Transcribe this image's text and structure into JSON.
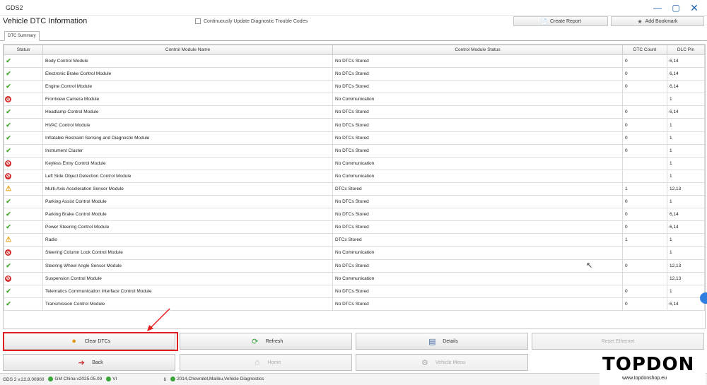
{
  "app": {
    "title": "GDS2"
  },
  "header": {
    "title": "Vehicle DTC Information",
    "continuous_update_label": "Continuously Update Diagnostic Trouble Codes",
    "create_report_label": "Create Report",
    "add_bookmark_label": "Add Bookmark"
  },
  "tabs": {
    "summary": "DTC Summary"
  },
  "table": {
    "columns": {
      "status": "Status",
      "module": "Control Module Name",
      "module_status": "Control Module Status",
      "dtc_count": "DTC Count",
      "dlc_pin": "DLC Pin"
    },
    "rows": [
      {
        "status": "ok",
        "module": "Body Control Module",
        "module_status": "No DTCs Stored",
        "dtc_count": "0",
        "dlc_pin": "6,14"
      },
      {
        "status": "ok",
        "module": "Electronic Brake Control Module",
        "module_status": "No DTCs Stored",
        "dtc_count": "0",
        "dlc_pin": "6,14"
      },
      {
        "status": "ok",
        "module": "Engine Control Module",
        "module_status": "No DTCs Stored",
        "dtc_count": "0",
        "dlc_pin": "6,14"
      },
      {
        "status": "nocomm",
        "module": "Frontview Camera Module",
        "module_status": "No Communication",
        "dtc_count": "",
        "dlc_pin": "1"
      },
      {
        "status": "ok",
        "module": "Headlamp Control Module",
        "module_status": "No DTCs Stored",
        "dtc_count": "0",
        "dlc_pin": "6,14"
      },
      {
        "status": "ok",
        "module": "HVAC Control Module",
        "module_status": "No DTCs Stored",
        "dtc_count": "0",
        "dlc_pin": "1"
      },
      {
        "status": "ok",
        "module": "Inflatable Restraint Sensing and Diagnostic Module",
        "module_status": "No DTCs Stored",
        "dtc_count": "0",
        "dlc_pin": "1"
      },
      {
        "status": "ok",
        "module": "Instrument Cluster",
        "module_status": "No DTCs Stored",
        "dtc_count": "0",
        "dlc_pin": "1"
      },
      {
        "status": "nocomm",
        "module": "Keyless Entry Control Module",
        "module_status": "No Communication",
        "dtc_count": "",
        "dlc_pin": "1"
      },
      {
        "status": "nocomm",
        "module": "Left Side Object Detection Control Module",
        "module_status": "No Communication",
        "dtc_count": "",
        "dlc_pin": "1"
      },
      {
        "status": "warn",
        "module": "Multi-Axis Acceleration Sensor Module",
        "module_status": "DTCs Stored",
        "dtc_count": "1",
        "dlc_pin": "12,13"
      },
      {
        "status": "ok",
        "module": "Parking Assist Control Module",
        "module_status": "No DTCs Stored",
        "dtc_count": "0",
        "dlc_pin": "1"
      },
      {
        "status": "ok",
        "module": "Parking Brake Control Module",
        "module_status": "No DTCs Stored",
        "dtc_count": "0",
        "dlc_pin": "6,14"
      },
      {
        "status": "ok",
        "module": "Power Steering Control Module",
        "module_status": "No DTCs Stored",
        "dtc_count": "0",
        "dlc_pin": "6,14"
      },
      {
        "status": "warn",
        "module": "Radio",
        "module_status": "DTCs Stored",
        "dtc_count": "1",
        "dlc_pin": "1"
      },
      {
        "status": "nocomm",
        "module": "Steering Column Lock Control Module",
        "module_status": "No Communication",
        "dtc_count": "",
        "dlc_pin": "1"
      },
      {
        "status": "ok",
        "module": "Steering Wheel Angle Sensor Module",
        "module_status": "No DTCs Stored",
        "dtc_count": "0",
        "dlc_pin": "12,13"
      },
      {
        "status": "nocomm",
        "module": "Suspension Control Module",
        "module_status": "No Communication",
        "dtc_count": "",
        "dlc_pin": "12,13"
      },
      {
        "status": "ok",
        "module": "Telematics Communication Interface Control Module",
        "module_status": "No DTCs Stored",
        "dtc_count": "0",
        "dlc_pin": "1"
      },
      {
        "status": "ok",
        "module": "Transmission Control Module",
        "module_status": "No DTCs Stored",
        "dtc_count": "0",
        "dlc_pin": "6,14"
      }
    ]
  },
  "actions": {
    "clear_dtcs": "Clear DTCs",
    "refresh": "Refresh",
    "details": "Details",
    "reset_ethernet": "Reset Ethernet",
    "back": "Back",
    "home": "Home",
    "vehicle_menu": "Vehicle Menu"
  },
  "statusbar": {
    "version": "GDS 2 v.22.8.00900",
    "gm": "GM China v2025.05.09",
    "vin_partial": "VI",
    "vin_tail": "6",
    "vehicle": "2014,Chevrolet,Malibu,Vehicle Diagnostics"
  },
  "watermark": {
    "brand": "TOPDON",
    "url": "www.topdonshop.eu"
  },
  "colors": {
    "ok": "#4aa832",
    "nocomm": "#d42a2a",
    "warn": "#e6a21a",
    "highlight": "#e02020",
    "accent": "#1e5fa8"
  }
}
